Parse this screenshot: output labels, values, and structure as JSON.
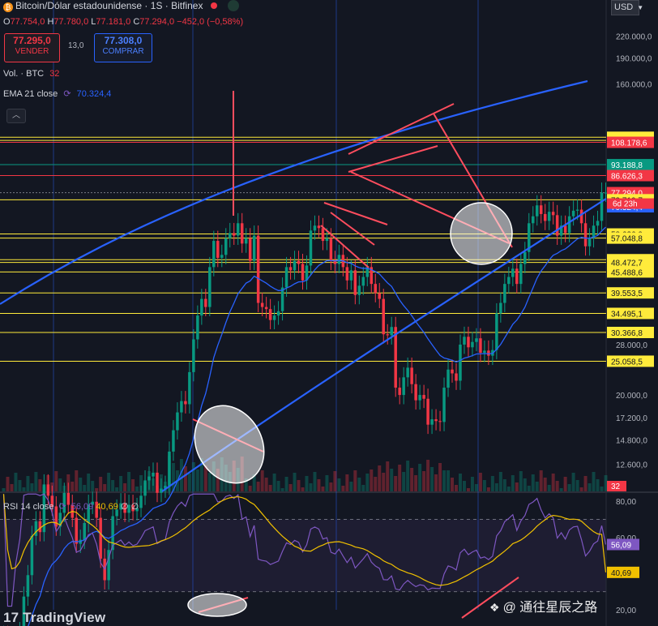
{
  "header": {
    "symbol": "Bitcoin/Dólar estadounidense · 1S · Bitfinex",
    "ohlc": {
      "o_label": "O",
      "o": "77.754,0",
      "h_label": "H",
      "h": "77.780,0",
      "l_label": "L",
      "l": "77.181,0",
      "c_label": "C",
      "c": "77.294,0",
      "change": "−452,0 (−0,58%)"
    }
  },
  "trade": {
    "sell_price": "77.295,0",
    "sell_label": "VENDER",
    "spread": "13,0",
    "buy_price": "77.308,0",
    "buy_label": "COMPRAR"
  },
  "indicators": {
    "vol_label": "Vol. · BTC",
    "vol_value": "32",
    "ema_label": "EMA 21 close",
    "ema_value": "70.324,4",
    "rsi_label": "RSI 14 close",
    "rsi_value": "56,09",
    "rsi_ma": "40,69",
    "rsi_extra1": "∅",
    "rsi_extra2": "∅"
  },
  "currency": "USD",
  "branding": {
    "tradingview": "TradingView",
    "watermark": "@ 通往星辰之路"
  },
  "colors": {
    "bg": "#131722",
    "up": "#089981",
    "down": "#f23645",
    "ema": "#2962ff",
    "rsi": "#7e57c2",
    "rsi_ma": "#f0c000",
    "level": "#ffeb3b",
    "trend": "#ff4d5e"
  },
  "chart_data": {
    "type": "candlestick",
    "scale": "log",
    "ylim": [
      10500,
      280000
    ],
    "x_periods": 150,
    "close": [
      4000,
      3800,
      3600,
      3900,
      4100,
      5200,
      6000,
      7800,
      8600,
      8000,
      11000,
      10200,
      9500,
      8300,
      9100,
      10400,
      9600,
      8800,
      7400,
      7600,
      8500,
      9600,
      9800,
      8800,
      6700,
      5800,
      7100,
      8900,
      9300,
      9700,
      9100,
      9600,
      9200,
      9400,
      10200,
      11300,
      11600,
      11900,
      10400,
      10700,
      10900,
      13700,
      15800,
      17800,
      19200,
      18800,
      23300,
      29000,
      34000,
      38000,
      36000,
      47000,
      56000,
      50000,
      51000,
      57000,
      59000,
      58000,
      63000,
      55000,
      57000,
      49000,
      58000,
      37000,
      36000,
      35500,
      33000,
      34000,
      35000,
      41000,
      47000,
      46000,
      49000,
      48000,
      43000,
      47500,
      60000,
      62000,
      61000,
      56000,
      57000,
      49000,
      48000,
      51000,
      47000,
      43000,
      46000,
      39000,
      41500,
      44000,
      47000,
      42000,
      39500,
      38000,
      30000,
      29800,
      31500,
      21000,
      20000,
      22500,
      24000,
      21500,
      19300,
      20000,
      19500,
      16400,
      17000,
      16800,
      16700,
      21000,
      23700,
      23100,
      22000,
      28000,
      29500,
      27500,
      28500,
      29200,
      26500,
      26900,
      26000,
      27000,
      34500,
      37000,
      42000,
      44000,
      46500,
      42000,
      48000,
      52000,
      63000,
      66000,
      71000,
      67000,
      64000,
      68000,
      66500,
      58000,
      62000,
      59000,
      66000,
      68500,
      69000,
      63000,
      54000,
      57000,
      62000,
      64000,
      77294,
      77294
    ],
    "price_levels": [
      "111.894,5",
      "109.556,3",
      "108.178,6",
      "93.188,8",
      "86.626,3",
      "77.294,0",
      "73.710,7",
      "70.324,4",
      "58.636,0",
      "57.048,8",
      "49.383,0",
      "48.472,7",
      "45.488,6",
      "39.553,5",
      "34.495,1",
      "30.366,8",
      "25.058,5"
    ],
    "price_tag_extra": "6d 23h",
    "axis_ticks": [
      "220.000,0",
      "190.000,0",
      "160.000,0",
      "28.000,0",
      "20.000,0",
      "17.200,0",
      "14.800,0",
      "12.600,0"
    ],
    "volume_last": "32",
    "rsi": {
      "ticks": [
        "80,00",
        "60,00",
        "20,00"
      ],
      "upper": 70,
      "lower": 30,
      "ylim": [
        20,
        85
      ],
      "value": 56.09,
      "ma": 40.69
    }
  }
}
